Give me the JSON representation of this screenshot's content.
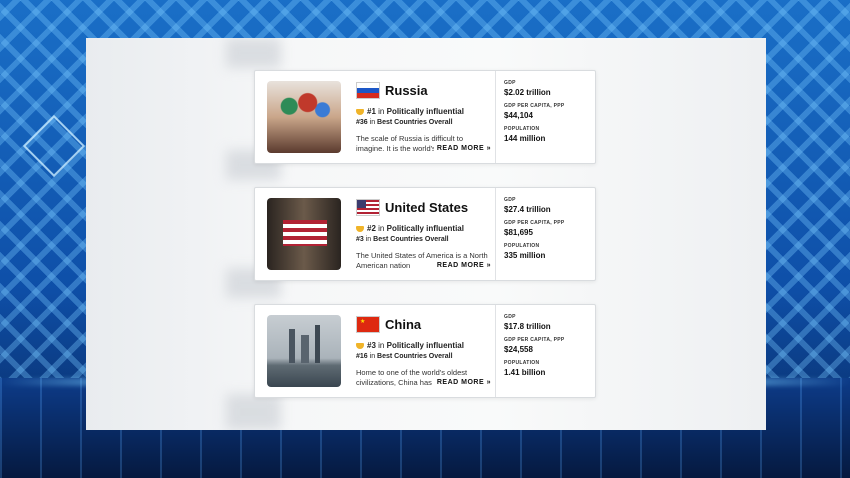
{
  "labels": {
    "gdp": "GDP",
    "gdp_per_capita": "GDP PER CAPITA, PPP",
    "population": "POPULATION",
    "read_more": "READ MORE »"
  },
  "countries": [
    {
      "name": "Russia",
      "rank_primary_num": "#1",
      "rank_primary_in": "in",
      "rank_primary_cat": "Politically influential",
      "rank_overall_num": "#36",
      "rank_overall_in": "in",
      "rank_overall_cat": "Best Countries Overall",
      "description": "The scale of Russia is difficult to imagine. It is the world's",
      "gdp": "$2.02 trillion",
      "gdp_per_capita": "$44,104",
      "population": "144 million"
    },
    {
      "name": "United States",
      "rank_primary_num": "#2",
      "rank_primary_in": "in",
      "rank_primary_cat": "Politically influential",
      "rank_overall_num": "#3",
      "rank_overall_in": "in",
      "rank_overall_cat": "Best Countries Overall",
      "description": "The United States of America is a North American nation",
      "gdp": "$27.4 trillion",
      "gdp_per_capita": "$81,695",
      "population": "335 million"
    },
    {
      "name": "China",
      "rank_primary_num": "#3",
      "rank_primary_in": "in",
      "rank_primary_cat": "Politically influential",
      "rank_overall_num": "#16",
      "rank_overall_in": "in",
      "rank_overall_cat": "Best Countries Overall",
      "description": "Home to one of the world's oldest civilizations, China has",
      "gdp": "$17.8 trillion",
      "gdp_per_capita": "$24,558",
      "population": "1.41 billion"
    }
  ]
}
